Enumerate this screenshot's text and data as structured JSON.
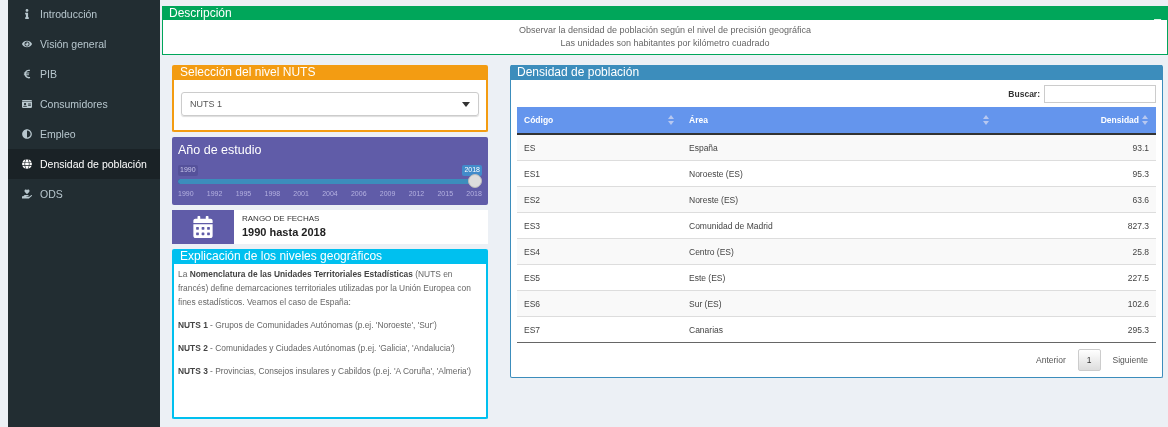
{
  "sidebar": {
    "items": [
      {
        "label": "Introducción",
        "selected": false
      },
      {
        "label": "Visión general",
        "selected": false
      },
      {
        "label": "PIB",
        "selected": false
      },
      {
        "label": "Consumidores",
        "selected": false
      },
      {
        "label": "Empleo",
        "selected": false
      },
      {
        "label": "Densidad de población",
        "selected": true
      },
      {
        "label": "ODS",
        "selected": false
      }
    ]
  },
  "description": {
    "title": "Descripción",
    "collapse": "_",
    "lines": [
      "Observar la densidad de población según el nivel de precisión geográfica",
      "Las unidades son habitantes por kilómetro cuadrado"
    ]
  },
  "nuts_box": {
    "title": "Selección del nivel NUTS",
    "select": {
      "value": "NUTS 1"
    }
  },
  "year_box": {
    "title": "Año de estudio",
    "slider": {
      "min_label": "1990",
      "value_label": "2018",
      "level": 1,
      "ticks": [
        "1990",
        "1992",
        "1995",
        "1998",
        "2001",
        "2004",
        "2006",
        "2009",
        "2012",
        "2015",
        "2018"
      ]
    }
  },
  "info_box": {
    "label": "RANGO DE FECHAS",
    "value": "1990 hasta 2018"
  },
  "explain_box": {
    "title": "Explicación de los niveles geográficos",
    "paragraphs": [
      "La **Nomenclatura de las Unidades Territoriales Estadísticas** (NUTS en francés) define demarcaciones territoriales utilizadas por la Unión Europea con fines estadísticos. Veamos el caso de España:",
      "**NUTS 1** - Grupos de Comunidades Autónomas (p.ej. 'Noroeste', 'Sur')",
      "**NUTS 2** - Comunidades y Ciudades Autónomas (p.ej. 'Galicia', 'Andalucia')",
      "**NUTS 3** - Provincias, Consejos insulares y Cabildos (p.ej. 'A Coruña', 'Almeria')"
    ]
  },
  "table_box": {
    "title": "Densidad de población",
    "search_label": "Buscar:",
    "columns": [
      "Código",
      "Área",
      "Densidad"
    ],
    "rows": [
      [
        "ES",
        "España",
        "93.1"
      ],
      [
        "ES1",
        "Noroeste (ES)",
        "95.3"
      ],
      [
        "ES2",
        "Noreste (ES)",
        "63.6"
      ],
      [
        "ES3",
        "Comunidad de Madrid",
        "827.3"
      ],
      [
        "ES4",
        "Centro (ES)",
        "25.8"
      ],
      [
        "ES5",
        "Este (ES)",
        "227.5"
      ],
      [
        "ES6",
        "Sur (ES)",
        "102.6"
      ],
      [
        "ES7",
        "Canarias",
        "295.3"
      ]
    ],
    "pagination": {
      "previous": "Anterior",
      "pages": [
        {
          "label": "1",
          "selected": true
        }
      ],
      "next": "Siguiente"
    }
  }
}
